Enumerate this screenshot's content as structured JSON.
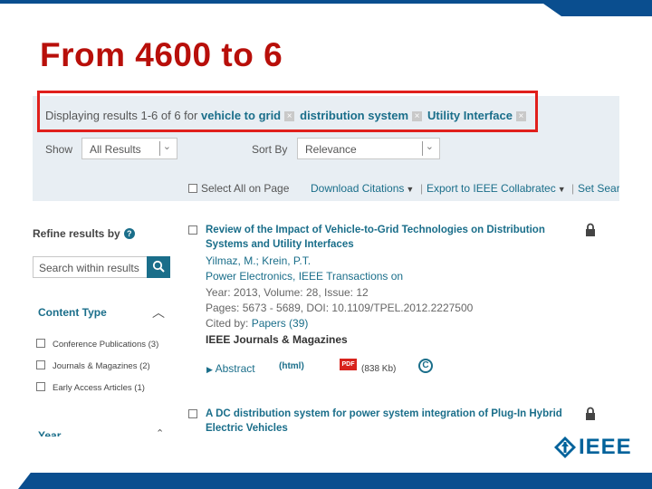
{
  "slide": {
    "title": "From 4600 to 6",
    "brand_color": "#00629b",
    "title_color": "#b80f0a",
    "highlight_color": "#e0201c"
  },
  "search": {
    "display_prefix": "Displaying results 1-6 of 6 for",
    "terms": [
      "vehicle to grid",
      "distribution system",
      "Utility Interface"
    ],
    "remove_glyph": "×",
    "show_label": "Show",
    "show_value": "All Results",
    "sort_label": "Sort By",
    "sort_value": "Relevance"
  },
  "toolbar": {
    "select_all": "Select All on Page",
    "download_citations": "Download Citations",
    "export": "Export to IEEE Collabratec",
    "set_search": "Set Sear"
  },
  "sidebar": {
    "refine_title": "Refine results by",
    "help_glyph": "?",
    "search_placeholder": "Search within results",
    "content_type_title": "Content Type",
    "content_type_items": [
      "Conference Publications (3)",
      "Journals & Magazines (2)",
      "Early Access Articles (1)"
    ],
    "year_title": "Year"
  },
  "results": [
    {
      "title": "Review of the Impact of Vehicle-to-Grid Technologies on Distribution Systems and Utility Interfaces",
      "authors": "Yilmaz, M.; Krein, P.T.",
      "source": "Power Electronics, IEEE Transactions on",
      "year_line": "Year: 2013, Volume: 28, Issue: 12",
      "pages_line": "Pages: 5673 - 5689, DOI: 10.1109/TPEL.2012.2227500",
      "cited_by_prefix": "Cited by:",
      "cited_by_link": "Papers (39)",
      "pub_type": "IEEE Journals & Magazines",
      "abstract_label": "Abstract",
      "html_label": "(html)",
      "pdf_icon": "PDF",
      "pdf_size": "(838 Kb)",
      "copyright_glyph": "C"
    },
    {
      "title": "A DC distribution system for power system integration of Plug-In Hybrid Electric Vehicles"
    }
  ],
  "logo": {
    "text": "IEEE"
  }
}
